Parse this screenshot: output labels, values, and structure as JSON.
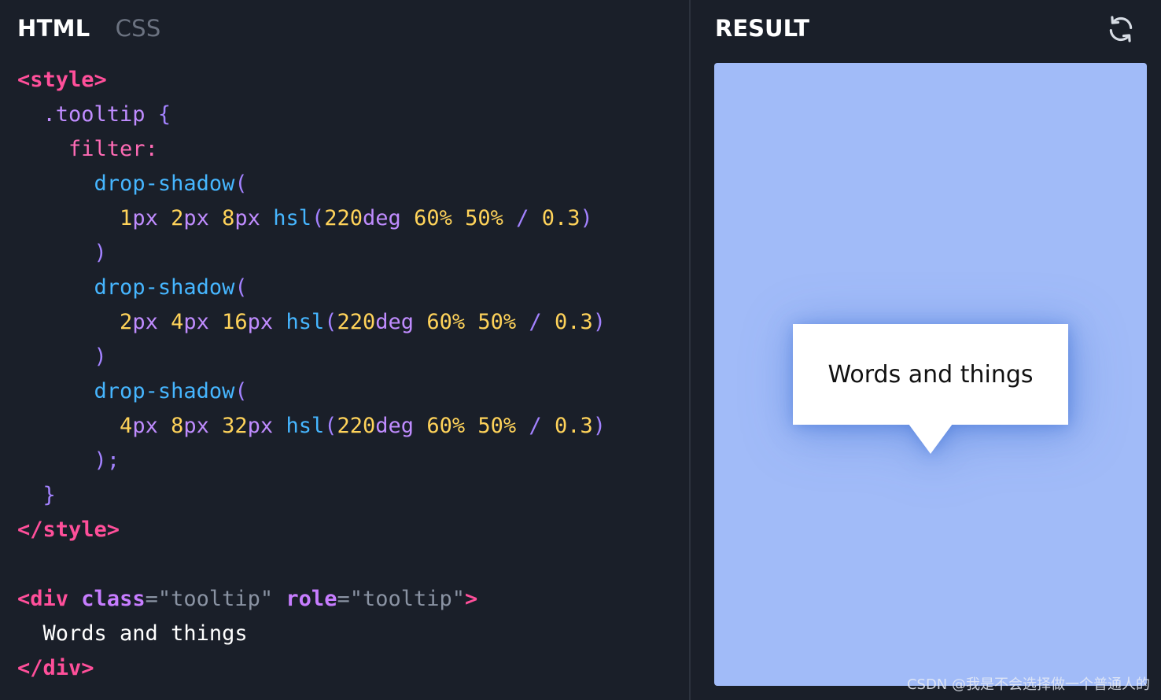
{
  "editor": {
    "tabs": [
      {
        "label": "HTML",
        "active": true
      },
      {
        "label": "CSS",
        "active": false
      }
    ],
    "code": {
      "l1_tag": "<style>",
      "l2_selector": ".tooltip",
      "l2_brace": "{",
      "l3_prop": "filter:",
      "fn": "drop-shadow",
      "paren_open": "(",
      "paren_close": ")",
      "shadow1": {
        "a": "1",
        "b": "2",
        "c": "8"
      },
      "shadow2": {
        "a": "2",
        "b": "4",
        "c": "16"
      },
      "shadow3": {
        "a": "4",
        "b": "8",
        "c": "32"
      },
      "unit_px": "px",
      "hsl_fn": "hsl",
      "hue": "220",
      "unit_deg": "deg",
      "sat": "60%",
      "light": "50%",
      "slash": "/",
      "alpha": "0.3",
      "semicolon": ";",
      "close_brace": "}",
      "close_style": "</style>",
      "div_open": "<div",
      "attr_class": "class",
      "eq": "=",
      "val_class": "\"tooltip\"",
      "attr_role": "role",
      "val_role": "\"tooltip\"",
      "gt": ">",
      "body_text": "Words and things",
      "div_close": "</div>"
    }
  },
  "result": {
    "title": "RESULT",
    "refresh_icon": "refresh-icon",
    "tooltip_text": "Words and things",
    "background_color": "#a1bbf8"
  },
  "watermark": "CSDN @我是不会选择做一个普通人的",
  "colors": {
    "background": "#1a1f29",
    "tag": "#ff4f9a",
    "selector": "#c08cff",
    "property": "#ff6bb5",
    "function": "#46b6ff",
    "number": "#ffd35a",
    "string": "#8a93a3"
  }
}
